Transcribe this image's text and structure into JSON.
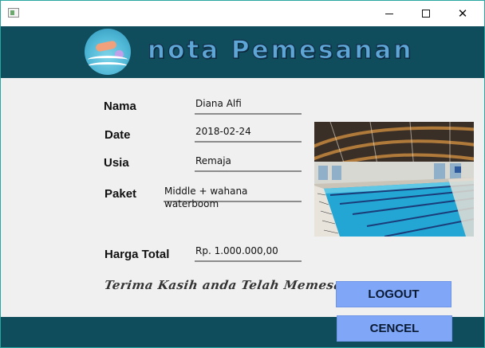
{
  "window": {
    "icon": "app-window-icon",
    "controls": {
      "minimize_icon": "minimize-icon",
      "maximize_icon": "maximize-icon",
      "close_icon": "close-icon",
      "close_glyph": "✕"
    }
  },
  "header": {
    "title": "nota Pemesanan",
    "logo": "swimmer-logo"
  },
  "form": {
    "nama": {
      "label": "Nama",
      "value": "Diana Alfi"
    },
    "date": {
      "label": "Date",
      "value": "2018-02-24"
    },
    "usia": {
      "label": "Usia",
      "value": "Remaja"
    },
    "paket": {
      "label": "Paket",
      "value": "Middle + wahana waterboom"
    },
    "harga": {
      "label": "Harga Total",
      "value": "Rp. 1.000.000,00"
    }
  },
  "image": "swimming-pool-photo",
  "thanks_text": "Terima Kasih anda Telah Memesan",
  "buttons": {
    "logout": "LOGOUT",
    "cancel": "CENCEL"
  },
  "colors": {
    "header_band": "#0f4c5c",
    "button": "#7fa6f7",
    "window_border": "#2aa6a0"
  }
}
